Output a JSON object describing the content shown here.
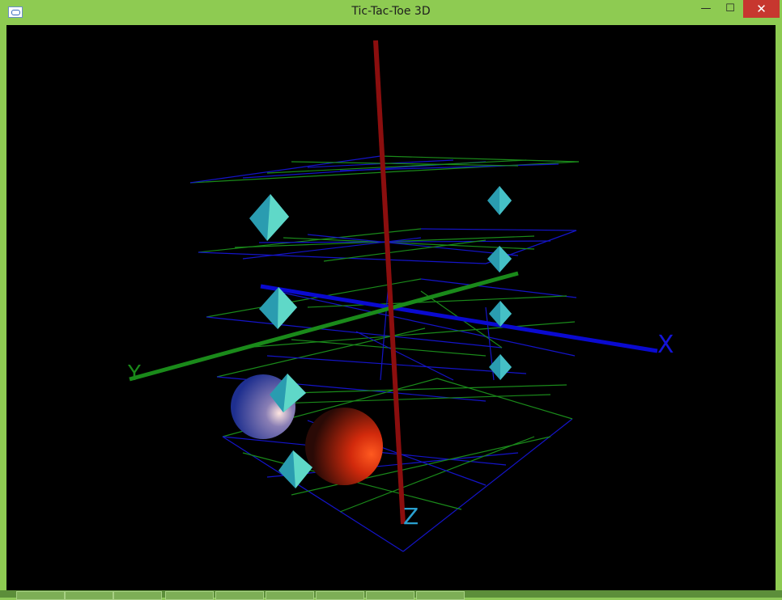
{
  "window": {
    "title": "Tic-Tac-Toe 3D"
  },
  "controls": {
    "minimize": "—",
    "maximize": "☐",
    "close": "✕"
  },
  "scene": {
    "axis_labels": {
      "x": "X",
      "y": "Y",
      "z": "Z"
    },
    "colors": {
      "background": "#000000",
      "x_axis": "#0a0ad0",
      "y_axis": "#1a8a1a",
      "z_axis": "#8b0e0e",
      "grid_blue": "#1414c8",
      "grid_green": "#1a8a1a",
      "octahedron": "#2fa8b8",
      "sphere_blue": "#2a3d9a",
      "sphere_red": "#c42a10"
    }
  },
  "taskbar": {
    "buttons": [
      "app1",
      "app2",
      "app3",
      "app4",
      "app5",
      "app6",
      "app7",
      "app8",
      "app9"
    ]
  }
}
